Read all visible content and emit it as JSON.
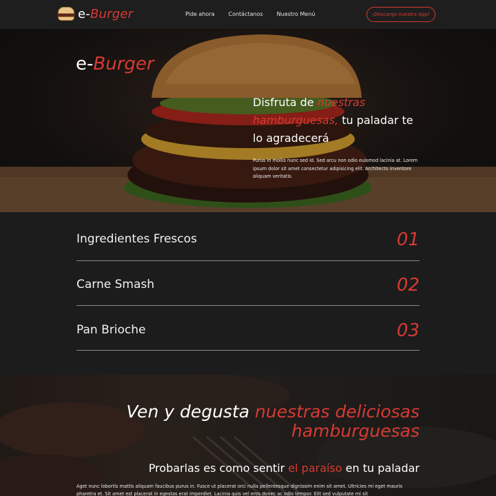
{
  "brand": {
    "prefix": "e-",
    "name": "Burger"
  },
  "nav": {
    "links": [
      "Pide ahora",
      "Contáctanos",
      "Nuestro Menú"
    ],
    "cta": "¡Descarga nuestra App!"
  },
  "hero": {
    "title_prefix": "e-",
    "title_name": "Burger",
    "heading_a": "Disfruta de ",
    "heading_highlight": "nuestras hamburguesas,",
    "heading_b": " tu paladar te lo agradecerá",
    "body": "Purus in mollis nunc sed id. Sed arcu non odio euismod lacinia at. Lorem ipsum dolor sit amet consectetur adipisicing elit. Architecto inventore aliquam veritatis."
  },
  "features": [
    {
      "label": "Ingredientes Frescos",
      "number": "01"
    },
    {
      "label": "Carne Smash",
      "number": "02"
    },
    {
      "label": "Pan Brioche",
      "number": "03"
    }
  ],
  "promo": {
    "heading_a": "Ven y degusta ",
    "heading_highlight": "nuestras deliciosas hamburguesas",
    "sub_a": "Probarlas es como sentir ",
    "sub_highlight": "el paraíso",
    "sub_b": " en tu paladar",
    "body": "Aget nunc lobortis mattis aliquam faucibus purus in. Fusce ut placerat orci nulla pellentesque dignissim enim sit amet. Ultricies mi eget mauris pharetra et. Sit amet est placerat in egestas erat imperdiet. Lacinia quis vel eros donec ac odio tempor. Elit sed vulputate mi sit"
  },
  "colors": {
    "accent": "#d63a33",
    "background": "#1c1c1c"
  }
}
